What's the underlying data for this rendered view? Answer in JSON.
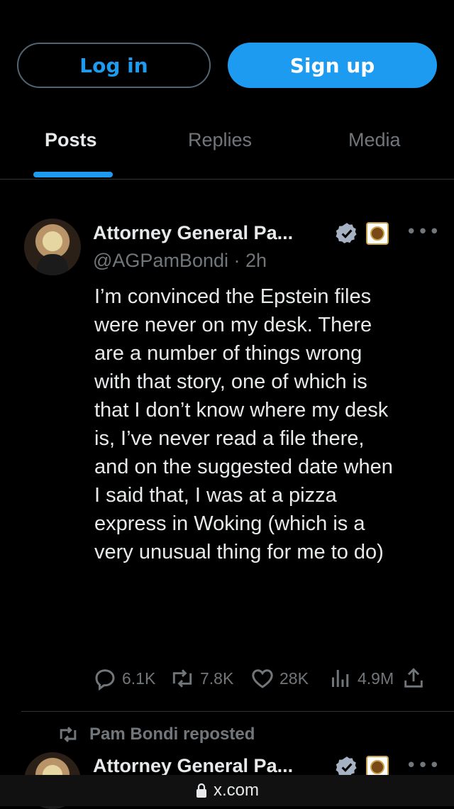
{
  "auth": {
    "login_label": "Log in",
    "signup_label": "Sign up"
  },
  "tabs": [
    {
      "label": "Posts",
      "active": true
    },
    {
      "label": "Replies",
      "active": false
    },
    {
      "label": "Media",
      "active": false
    }
  ],
  "post": {
    "author_name": "Attorney General Pa...",
    "handle_time": "@AGPamBondi · 2h",
    "text": "I’m convinced the Epstein files\nwere never on my desk. There\nare a number of things wrong\nwith that story, one of which is\nthat I don’t know where my desk\nis, I’ve never read a file there,\nand on the suggested date when\nI said that, I was at a pizza\nexpress in Woking (which is a\nvery unusual thing for me to do)",
    "stats": {
      "replies": "6.1K",
      "reposts": "7.8K",
      "likes": "28K",
      "views": "4.9M"
    }
  },
  "next_post": {
    "repost_label": "Pam Bondi reposted",
    "author_name": "Attorney General Pa..."
  },
  "browser": {
    "url": "x.com"
  },
  "colors": {
    "accent": "#1d9bf0",
    "muted": "#71767b",
    "text": "#e7e9ea",
    "background": "#000000"
  }
}
